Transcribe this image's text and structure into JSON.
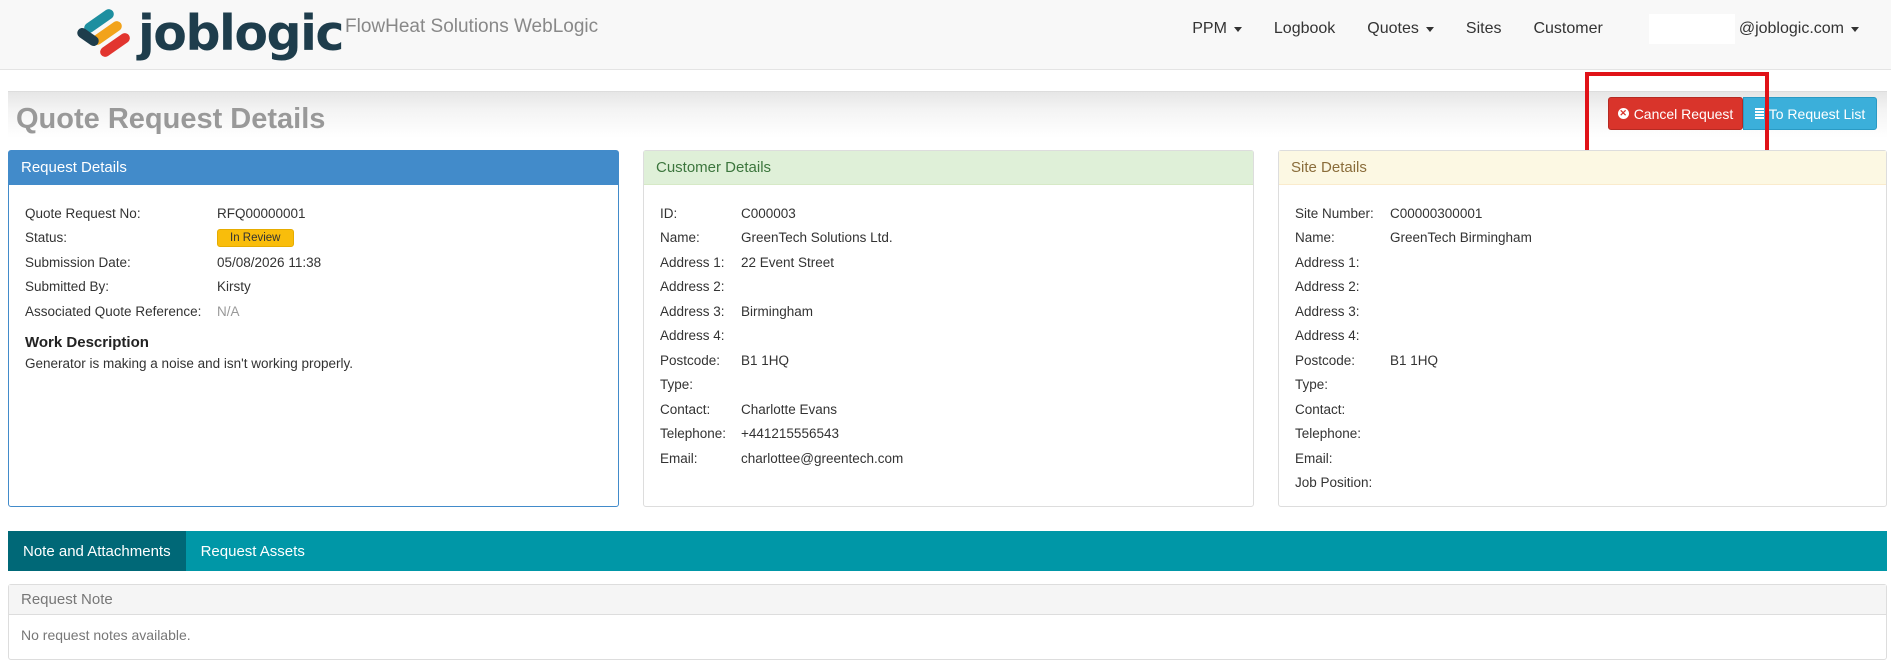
{
  "navbar": {
    "brand": "joblogic",
    "app_name": "FlowHeat Solutions WebLogic",
    "items": [
      {
        "label": "PPM",
        "dropdown": true
      },
      {
        "label": "Logbook",
        "dropdown": false
      },
      {
        "label": "Quotes",
        "dropdown": true
      },
      {
        "label": "Sites",
        "dropdown": false
      },
      {
        "label": "Customer",
        "dropdown": false
      }
    ],
    "user_email": "@joblogic.com"
  },
  "header": {
    "title": "Quote Request Details",
    "cancel_label": "Cancel Request",
    "list_label": "To Request List"
  },
  "request": {
    "heading": "Request Details",
    "quote_no_label": "Quote Request No:",
    "quote_no": "RFQ00000001",
    "status_label": "Status:",
    "status": "In Review",
    "submission_label": "Submission Date:",
    "submission": "05/08/2026 11:38",
    "submitted_by_label": "Submitted By:",
    "submitted_by": "Kirsty",
    "assoc_label": "Associated Quote Reference:",
    "assoc": "N/A",
    "work_title": "Work Description",
    "work_text": "Generator is making a noise and isn't working properly."
  },
  "customer": {
    "heading": "Customer Details",
    "rows": [
      {
        "label": "ID:",
        "value": "C000003"
      },
      {
        "label": "Name:",
        "value": "GreenTech Solutions Ltd."
      },
      {
        "label": "Address 1:",
        "value": "22 Event Street"
      },
      {
        "label": "Address 2:",
        "value": ""
      },
      {
        "label": "Address 3:",
        "value": "Birmingham"
      },
      {
        "label": "Address 4:",
        "value": ""
      },
      {
        "label": "Postcode:",
        "value": "B1 1HQ"
      },
      {
        "label": "Type:",
        "value": ""
      },
      {
        "label": "Contact:",
        "value": "Charlotte Evans"
      },
      {
        "label": "Telephone:",
        "value": "+441215556543"
      },
      {
        "label": "Email:",
        "value": "charlottee@greentech.com"
      }
    ]
  },
  "site": {
    "heading": "Site Details",
    "rows": [
      {
        "label": "Site Number:",
        "value": "C00000300001"
      },
      {
        "label": "Name:",
        "value": "GreenTech Birmingham"
      },
      {
        "label": "Address 1:",
        "value": ""
      },
      {
        "label": "Address 2:",
        "value": ""
      },
      {
        "label": "Address 3:",
        "value": ""
      },
      {
        "label": "Address 4:",
        "value": ""
      },
      {
        "label": "Postcode:",
        "value": "B1 1HQ"
      },
      {
        "label": "Type:",
        "value": ""
      },
      {
        "label": "Contact:",
        "value": ""
      },
      {
        "label": "Telephone:",
        "value": ""
      },
      {
        "label": "Email:",
        "value": ""
      },
      {
        "label": "Job Position:",
        "value": ""
      }
    ]
  },
  "tabs": [
    {
      "label": "Note and Attachments",
      "active": true
    },
    {
      "label": "Request Assets",
      "active": false
    }
  ],
  "note": {
    "heading": "Request Note",
    "empty_text": "No request notes available."
  },
  "colors": {
    "cancel": "#d9342b",
    "list": "#3bafda",
    "tabbar": "#0097a7",
    "highlight": "#e01218"
  }
}
